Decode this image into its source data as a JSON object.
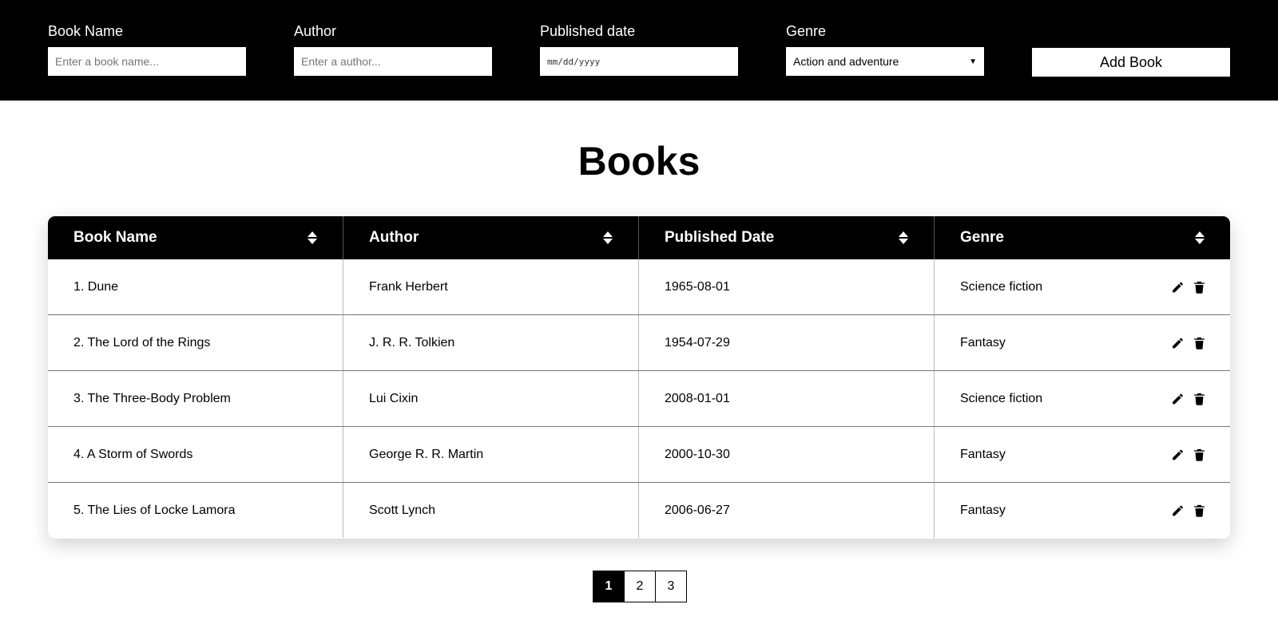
{
  "form": {
    "book_name": {
      "label": "Book Name",
      "placeholder": "Enter a book name..."
    },
    "author": {
      "label": "Author",
      "placeholder": "Enter a author..."
    },
    "published_date": {
      "label": "Published date",
      "placeholder": "mm/dd/yyyy"
    },
    "genre": {
      "label": "Genre",
      "selected": "Action and adventure"
    },
    "add_button": "Add Book"
  },
  "title": "Books",
  "table": {
    "headers": [
      "Book Name",
      "Author",
      "Published Date",
      "Genre"
    ],
    "rows": [
      {
        "name": "1. Dune",
        "author": "Frank Herbert",
        "date": "1965-08-01",
        "genre": "Science fiction"
      },
      {
        "name": "2. The Lord of the Rings",
        "author": "J. R. R. Tolkien",
        "date": "1954-07-29",
        "genre": "Fantasy"
      },
      {
        "name": "3. The Three-Body Problem",
        "author": "Lui Cixin",
        "date": "2008-01-01",
        "genre": "Science fiction"
      },
      {
        "name": "4. A Storm of Swords",
        "author": "George R. R. Martin",
        "date": "2000-10-30",
        "genre": "Fantasy"
      },
      {
        "name": "5. The Lies of Locke Lamora",
        "author": "Scott Lynch",
        "date": "2006-06-27",
        "genre": "Fantasy"
      }
    ],
    "row_actions": [
      "pencil-icon",
      "trash-icon"
    ]
  },
  "pagination": {
    "pages": [
      "1",
      "2",
      "3"
    ],
    "active": "1"
  },
  "colors": {
    "primary": "#000000",
    "background": "#ffffff"
  }
}
